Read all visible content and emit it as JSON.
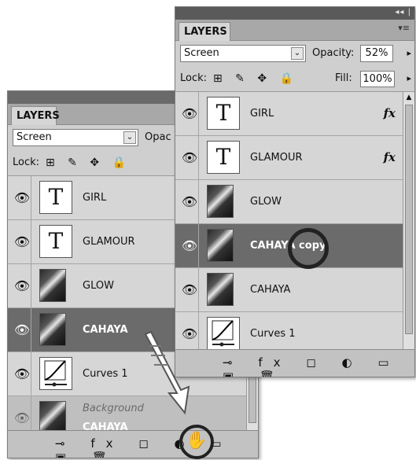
{
  "front": {
    "tab_label": "LAYERS",
    "blend_mode": "Screen",
    "opacity_label": "Opacity:",
    "opacity_value": "52%",
    "lock_label": "Lock:",
    "fill_label": "Fill:",
    "fill_value": "100%",
    "layers": [
      {
        "name": "GIRL",
        "thumb": "T",
        "fx": "fx"
      },
      {
        "name": "GLAMOUR",
        "thumb": "T",
        "fx": "fx"
      },
      {
        "name": "GLOW",
        "thumb": "photo"
      },
      {
        "name": "CAHAYA copy",
        "thumb": "photo",
        "selected": true
      },
      {
        "name": "CAHAYA",
        "thumb": "photo"
      },
      {
        "name": "Curves 1",
        "thumb": "curves"
      }
    ],
    "bottom_icons": [
      "link-icon",
      "fx-icon",
      "mask-icon",
      "adjustment-icon",
      "folder-icon",
      "new-layer-icon",
      "trash-icon"
    ]
  },
  "back": {
    "tab_label": "LAYERS",
    "blend_mode": "Screen",
    "opacity_label": "Opac",
    "lock_label": "Lock:",
    "layers": [
      {
        "name": "GIRL",
        "thumb": "T"
      },
      {
        "name": "GLAMOUR",
        "thumb": "T"
      },
      {
        "name": "GLOW",
        "thumb": "photo"
      },
      {
        "name": "CAHAYA",
        "thumb": "photo",
        "selected": true
      },
      {
        "name": "Curves 1",
        "thumb": "curves"
      },
      {
        "name": "Background",
        "thumb": "photo"
      },
      {
        "name": "CAHAYA",
        "thumb": "photo",
        "ghost": true
      }
    ]
  },
  "symbols": {
    "titlebar": "◂◂ |",
    "panel_menu": "▾≡",
    "dropdown_arrow": "⌄",
    "right_arrow": "▸",
    "lock_icons": "⊞ ✎ ✥ 🔒",
    "eye": "👁",
    "fx_arrow": "▾",
    "bottom_bar": "⊸ fx ◻ ◐ ▭ ▣ 🗑",
    "hand": "✋"
  }
}
